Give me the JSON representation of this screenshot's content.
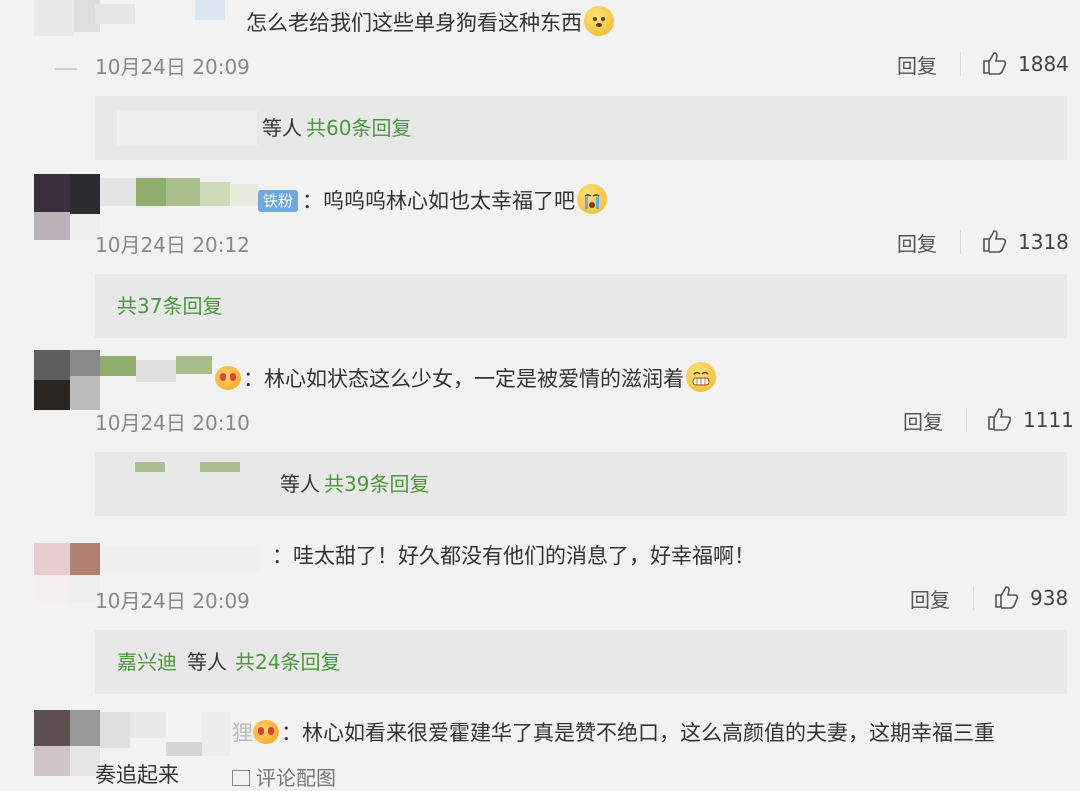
{
  "comments": [
    {
      "text": "怎么老给我们这些单身狗看这种东西",
      "time": "10月24日 20:09",
      "reply_label": "回复",
      "likes": "1884",
      "thread": {
        "who": "等人",
        "count": "共60条回复"
      }
    },
    {
      "badge": "铁粉",
      "colon": "：",
      "text": "呜呜呜林心如也太幸福了吧",
      "time": "10月24日 20:12",
      "reply_label": "回复",
      "likes": "1318",
      "thread": {
        "count": "共37条回复"
      }
    },
    {
      "colon": "：",
      "text": "林心如状态这么少女，一定是被爱情的滋润着",
      "time": "10月24日 20:10",
      "reply_label": "回复",
      "likes": "1111",
      "thread": {
        "who": "等人",
        "count": "共39条回复"
      }
    },
    {
      "colon": "：",
      "text": "哇太甜了！好久都没有他们的消息了，好幸福啊！",
      "time": "10月24日 20:09",
      "reply_label": "回复",
      "likes": "938",
      "thread": {
        "name": "嘉兴迪",
        "who": "等人",
        "count": "共24条回复"
      }
    },
    {
      "name_tail": "狸",
      "colon": "：",
      "text": "林心如看来很爱霍建华了真是赞不绝口，这么高颜值的夫妻，这期幸福三重",
      "text2": "奏追起来",
      "footer": "评论配图"
    }
  ],
  "colors": {
    "background": "#f2f2f2",
    "reply_box": "#e8e8e8",
    "link_green": "#4a9a3a",
    "badge_blue": "#6fa8dc"
  },
  "icons": [
    "thumbs-up-icon",
    "dog-emoji-icon",
    "crying-emoji-icon",
    "grin-emoji-icon",
    "crown-emoji-icon"
  ]
}
